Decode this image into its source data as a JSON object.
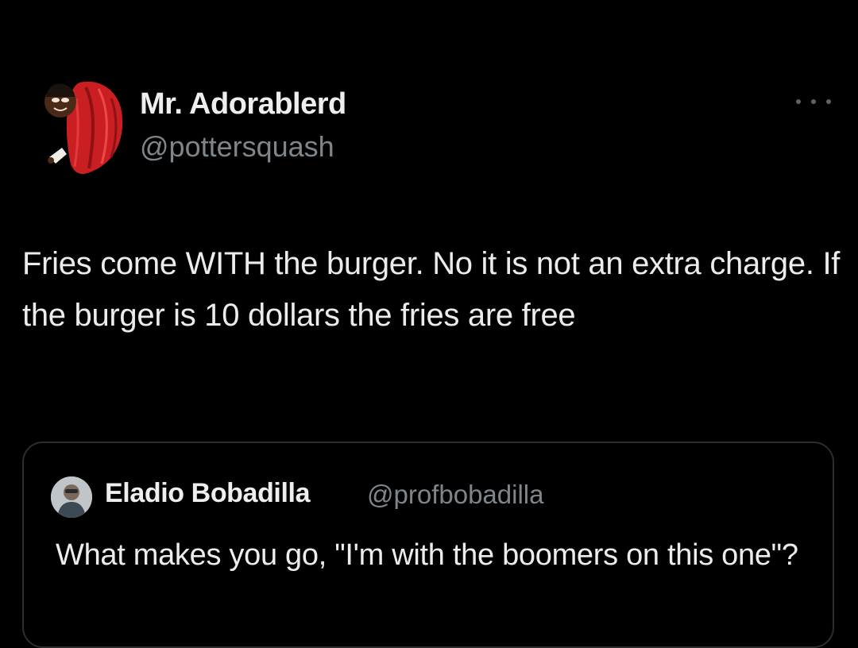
{
  "tweet": {
    "author": {
      "display_name": "Mr. Adorablerd",
      "handle": "@pottersquash",
      "avatar_icon": "profile-avatar-red-cloak"
    },
    "more_icon": "ellipsis-icon",
    "text": "Fries come WITH the burger. No it is not an extra charge. If the burger is 10 dollars the fries are free"
  },
  "quoted_tweet": {
    "author": {
      "display_name": "Eladio Bobadilla",
      "handle": "@profbobadilla",
      "avatar_icon": "profile-avatar-photo"
    },
    "text": "What makes you go, \"I'm with the boomers on this one\"?"
  },
  "colors": {
    "background": "#000000",
    "text_primary": "#ececec",
    "text_secondary": "#7f868b",
    "card_border": "#2b2e31",
    "avatar_accent": "#d42a2a"
  }
}
